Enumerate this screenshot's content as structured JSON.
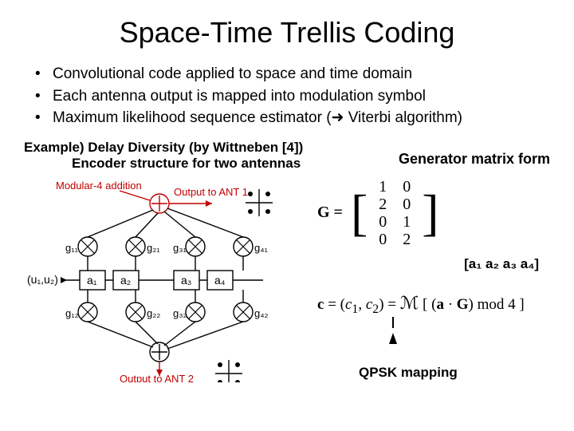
{
  "title": "Space-Time Trellis Coding",
  "bullets": [
    "Convolutional code applied to space and time domain",
    "Each antenna output is mapped into modulation symbol",
    "Maximum likelihood sequence estimator (➜ Viterbi algorithm)"
  ],
  "example": {
    "line1": "Example) Delay Diversity (by Wittneben [4])",
    "line2": "Encoder structure for two antennas"
  },
  "generator_matrix": {
    "label": "Generator matrix form",
    "lhs": "G =",
    "rows": [
      [
        "1",
        "0"
      ],
      [
        "2",
        "0"
      ],
      [
        "0",
        "1"
      ],
      [
        "0",
        "2"
      ]
    ]
  },
  "a_vector": "[a₁ a₂ a₃ a₄]",
  "formula": "c = (c₁, c₂) = ℳ [ (a · G) mod 4 ]",
  "qpsk_label": "QPSK mapping",
  "encoder": {
    "mod4_label": "Modular-4 addition",
    "out_top": "Output to ANT 1",
    "out_bot": "Output to ANT 2",
    "input_label": "(u₁,u₂)",
    "a_boxes": [
      "a₁",
      "a₂",
      "a₃",
      "a₄"
    ],
    "g_top": [
      "g₁₁",
      "g₂₁",
      "g₃₁",
      "g₄₁"
    ],
    "g_bot": [
      "g₁₂",
      "g₂₂",
      "g₃₂",
      "g₄₂"
    ]
  }
}
